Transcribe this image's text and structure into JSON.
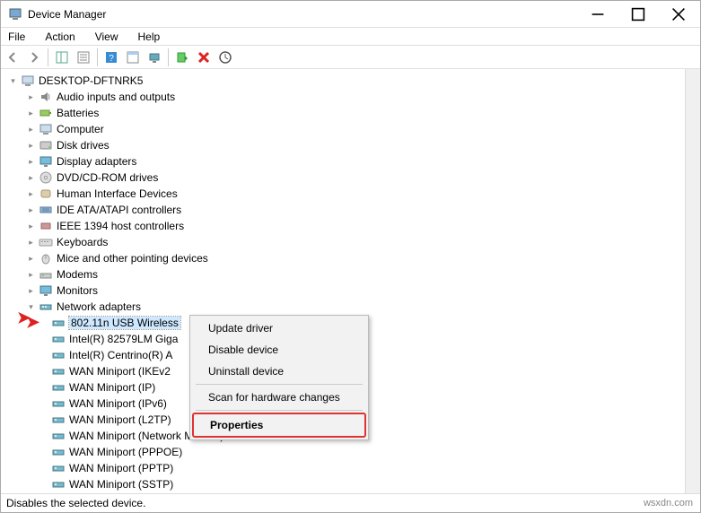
{
  "title": "Device Manager",
  "menu": {
    "file": "File",
    "action": "Action",
    "view": "View",
    "help": "Help"
  },
  "root": "DESKTOP-DFTNRK5",
  "categories": {
    "audio": "Audio inputs and outputs",
    "batteries": "Batteries",
    "computer": "Computer",
    "disk": "Disk drives",
    "display": "Display adapters",
    "dvd": "DVD/CD-ROM drives",
    "hid": "Human Interface Devices",
    "ide": "IDE ATA/ATAPI controllers",
    "ieee": "IEEE 1394 host controllers",
    "keyboards": "Keyboards",
    "mice": "Mice and other pointing devices",
    "modems": "Modems",
    "monitors": "Monitors",
    "network": "Network adapters"
  },
  "network_items": [
    "802.11n USB Wireless",
    "Intel(R) 82579LM Giga",
    "Intel(R) Centrino(R) A",
    "WAN Miniport (IKEv2",
    "WAN Miniport (IP)",
    "WAN Miniport (IPv6)",
    "WAN Miniport (L2TP)",
    "WAN Miniport (Network Monitor)",
    "WAN Miniport (PPPOE)",
    "WAN Miniport (PPTP)",
    "WAN Miniport (SSTP)"
  ],
  "context_menu": {
    "update": "Update driver",
    "disable": "Disable device",
    "uninstall": "Uninstall device",
    "scan": "Scan for hardware changes",
    "properties": "Properties"
  },
  "statusbar": "Disables the selected device.",
  "watermark": "wsxdn.com"
}
